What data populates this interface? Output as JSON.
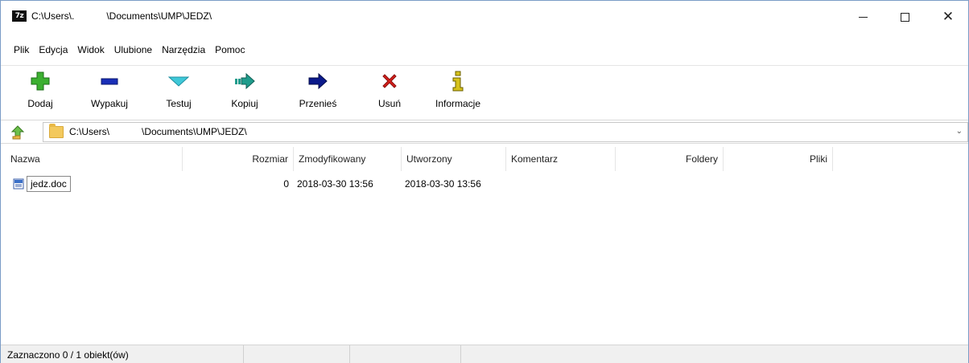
{
  "window": {
    "title": "C:\\Users\\.            \\Documents\\UMP\\JEDZ\\",
    "app_icon_text": "7z"
  },
  "menu": {
    "items": [
      "Plik",
      "Edycja",
      "Widok",
      "Ulubione",
      "Narzędzia",
      "Pomoc"
    ]
  },
  "toolbar": {
    "add": "Dodaj",
    "extract": "Wypakuj",
    "test": "Testuj",
    "copy": "Kopiuj",
    "move": "Przenieś",
    "delete": "Usuń",
    "info": "Informacje"
  },
  "address": {
    "path": "C:\\Users\\            \\Documents\\UMP\\JEDZ\\"
  },
  "columns": {
    "name": "Nazwa",
    "size": "Rozmiar",
    "modified": "Zmodyfikowany",
    "created": "Utworzony",
    "comment": "Komentarz",
    "folders": "Foldery",
    "files": "Pliki"
  },
  "files": [
    {
      "name": "jedz.doc",
      "size": "0",
      "modified": "2018-03-30 13:56",
      "created": "2018-03-30 13:56"
    }
  ],
  "status": {
    "selection": "Zaznaczono 0 / 1 obiekt(ów)"
  },
  "colors": {
    "add_green": "#3cb031",
    "extract_blue": "#1a2fb8",
    "test_cyan": "#3fc8d8",
    "copy_teal": "#1f9c8c",
    "move_navy": "#0b1a8c",
    "delete_red": "#d8201c",
    "info_yellow": "#d6c21a"
  }
}
